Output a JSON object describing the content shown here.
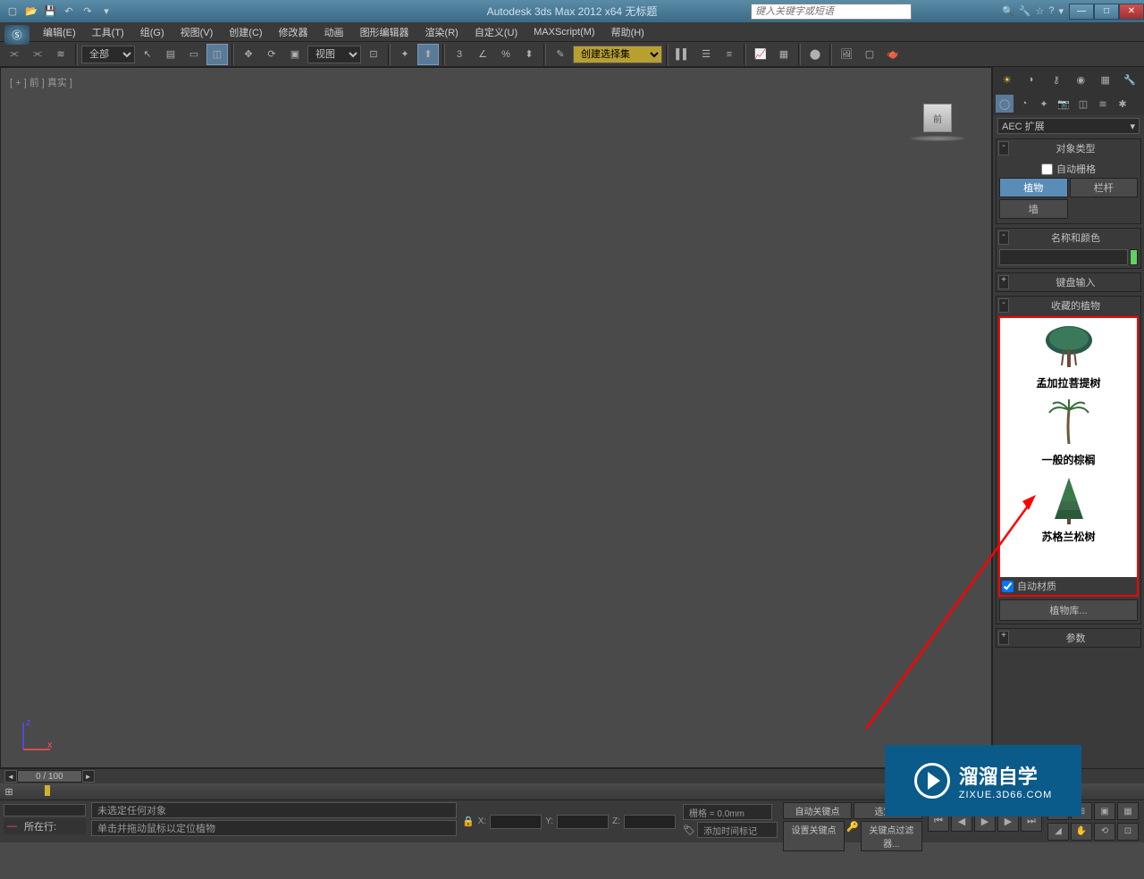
{
  "app": {
    "title": "Autodesk 3ds Max 2012 x64   无标题",
    "search_placeholder": "键入关键字或短语"
  },
  "menu": {
    "items": [
      "编辑(E)",
      "工具(T)",
      "组(G)",
      "视图(V)",
      "创建(C)",
      "修改器",
      "动画",
      "图形编辑器",
      "渲染(R)",
      "自定义(U)",
      "MAXScript(M)",
      "帮助(H)"
    ]
  },
  "toolbar": {
    "filter_all": "全部",
    "view_combo": "视图",
    "named_sel": "创建选择集"
  },
  "viewport": {
    "label": "[ + ] 前 ] 真实 ]",
    "cube_face": "前"
  },
  "cmdpanel": {
    "category": "AEC 扩展",
    "rollouts": {
      "object_type": "对象类型",
      "auto_grid": "自动栅格",
      "name_color": "名称和颜色",
      "keyboard": "键盘输入",
      "fav_plants": "收藏的植物",
      "auto_material": "自动材质",
      "plant_lib": "植物库...",
      "params": "参数"
    },
    "obj_types": {
      "plant": "植物",
      "railing": "栏杆",
      "wall": "墙"
    },
    "plants": [
      {
        "name": "孟加拉菩提树"
      },
      {
        "name": "一般的棕榈"
      },
      {
        "name": "苏格兰松树"
      }
    ]
  },
  "timeline": {
    "slider_label": "0 / 100"
  },
  "status": {
    "line1": "未选定任何对象",
    "line2": "单击并拖动鼠标以定位植物",
    "row_label": "所在行:",
    "grid": "栅格 = 0.0mm",
    "add_time_tag": "添加时间标记",
    "auto_key": "自动关键点",
    "set_key": "设置关键点",
    "key_filter": "关键点过滤器...",
    "sel_obj": "选定对",
    "x": "X:",
    "y": "Y:",
    "z": "Z:"
  },
  "watermark": {
    "main": "溜溜自学",
    "sub": "ZIXUE.3D66.COM"
  }
}
